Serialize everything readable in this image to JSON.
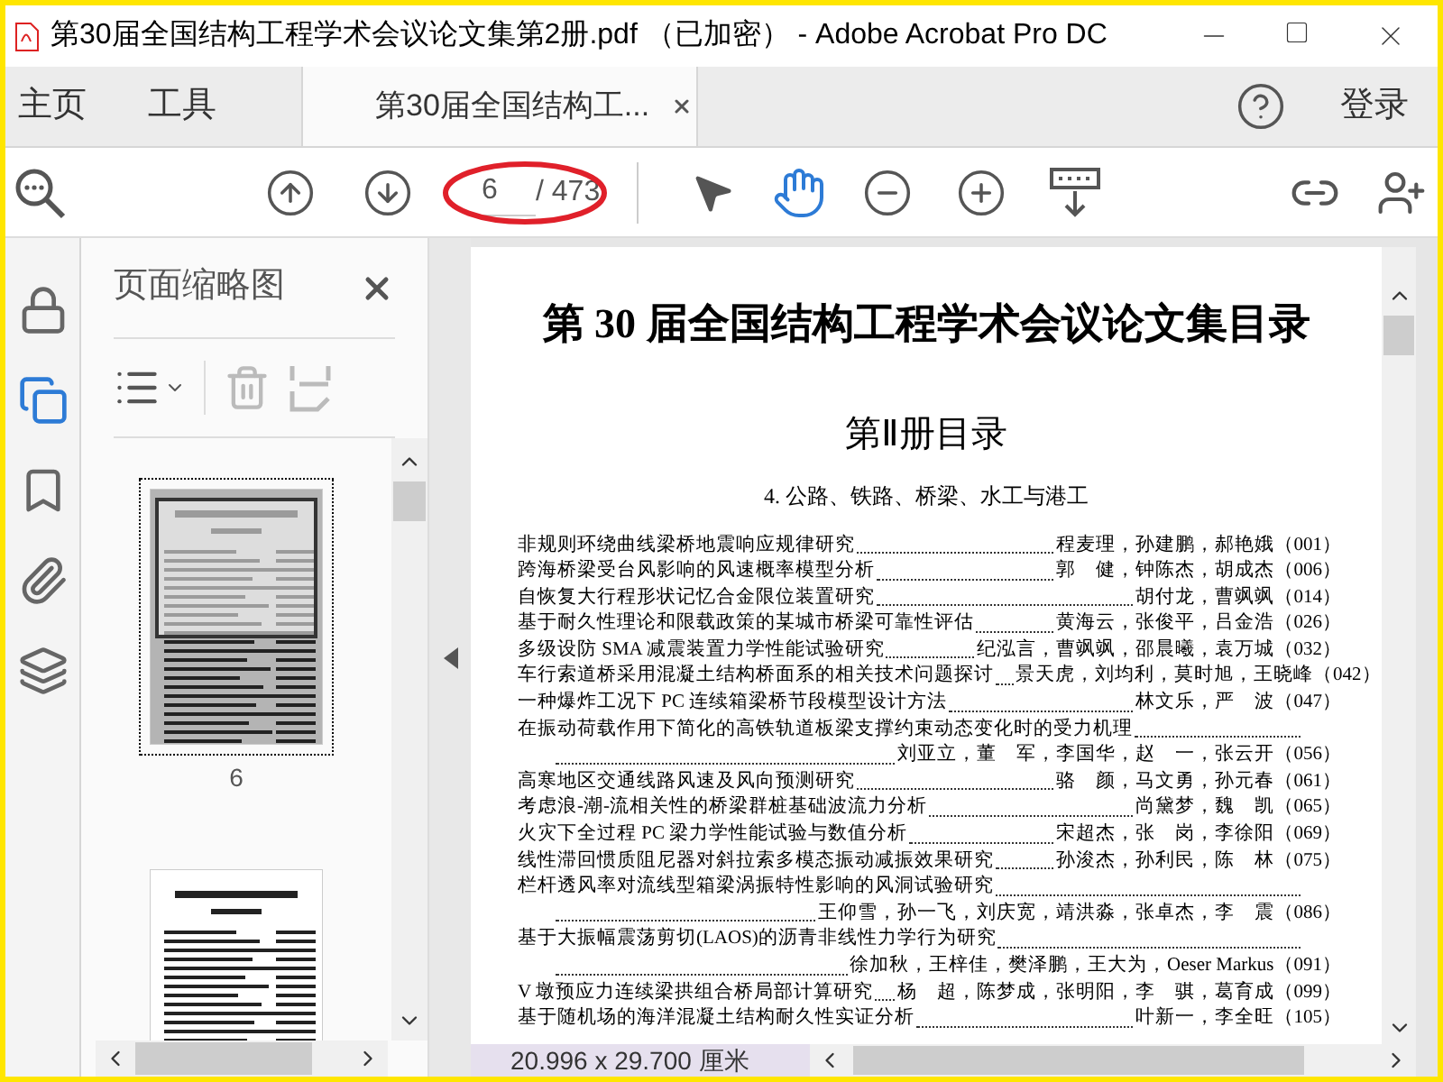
{
  "window": {
    "title": "第30届全国结构工程学术会议论文集第2册.pdf （已加密） - Adobe Acrobat Pro DC"
  },
  "tabs": [
    {
      "kind": "nav",
      "label": "主页",
      "selected": false
    },
    {
      "kind": "nav",
      "label": "工具",
      "selected": false
    },
    {
      "kind": "document",
      "label": "第30届全国结构工...",
      "selected": true
    }
  ],
  "sign_in": "登录",
  "page_field": {
    "value": "6",
    "total": "/ 473"
  },
  "rail": [
    {
      "kind": "lock",
      "selected": false
    },
    {
      "kind": "pages",
      "selected": true
    },
    {
      "kind": "bookmark",
      "selected": false
    },
    {
      "kind": "attachment",
      "selected": false
    },
    {
      "kind": "layers",
      "selected": false
    }
  ],
  "thumbnails": {
    "title": "页面缩略图",
    "pages": [
      {
        "label": "6",
        "selected": true
      },
      {
        "selected": false
      }
    ]
  },
  "document": {
    "heading": "第 30 届全国结构工程学术会议论文集目录",
    "subheading": "第Ⅱ册目录",
    "section": "4. 公路、铁路、桥梁、水工与港工",
    "entries": [
      {
        "kind": "single",
        "title": "非规则环绕曲线梁桥地震响应规律研究",
        "authors": "程麦理，孙建鹏，郝艳娥",
        "page": "（001）"
      },
      {
        "kind": "single",
        "title": "跨海桥梁受台风影响的风速概率模型分析",
        "authors": "郭　健，钟陈杰，胡成杰",
        "page": "（006）"
      },
      {
        "kind": "single",
        "title": "自恢复大行程形状记忆合金限位装置研究",
        "authors": "胡付龙，曹飒飒",
        "page": "（014）"
      },
      {
        "kind": "single",
        "title": "基于耐久性理论和限载政策的某城市桥梁可靠性评估",
        "authors": "黄海云，张俊平，吕金浩",
        "page": "（026）"
      },
      {
        "kind": "single",
        "title": "多级设防 SMA 减震装置力学性能试验研究",
        "authors": "纪泓言，曹飒飒，邵晨曦，袁万城",
        "page": "（032）"
      },
      {
        "kind": "single",
        "title": "车行索道桥采用混凝土结构桥面系的相关技术问题探讨",
        "authors": "景天虎，刘均利，莫时旭，王晓峰",
        "page": "（042）"
      },
      {
        "kind": "single",
        "title": "一种爆炸工况下 PC 连续箱梁桥节段模型设计方法",
        "authors": "林文乐，严　波",
        "page": "（047）"
      },
      {
        "kind": "wrapped",
        "title": "在振动荷载作用下简化的高铁轨道板梁支撑约束动态变化时的受力机理",
        "authors": "刘亚立，董　军，李国华，赵　一，张云开",
        "page": "（056）"
      },
      {
        "kind": "single",
        "title": "高寒地区交通线路风速及风向预测研究",
        "authors": "骆　颜，马文勇，孙元春",
        "page": "（061）"
      },
      {
        "kind": "single",
        "title": "考虑浪-潮-流相关性的桥梁群桩基础波流力分析",
        "authors": "尚黛梦，魏　凯",
        "page": "（065）"
      },
      {
        "kind": "single",
        "title": "火灾下全过程 PC 梁力学性能试验与数值分析",
        "authors": "宋超杰，张　岗，李徐阳",
        "page": "（069）"
      },
      {
        "kind": "single",
        "title": "线性滞回惯质阻尼器对斜拉索多模态振动减振效果研究",
        "authors": "孙浚杰，孙利民，陈　林",
        "page": "（075）"
      },
      {
        "kind": "wrapped",
        "title": "栏杆透风率对流线型箱梁涡振特性影响的风洞试验研究",
        "authors": "王仰雪，孙一飞，刘庆宽，靖洪淼，张卓杰，李　震",
        "page": "（086）"
      },
      {
        "kind": "wrapped",
        "title": "基于大振幅震荡剪切(LAOS)的沥青非线性力学行为研究",
        "authors": "徐加秋，王梓佳，樊泽鹏，王大为，Oeser Markus",
        "page": "（091）"
      },
      {
        "kind": "single",
        "title": "V 墩预应力连续梁拱组合桥局部计算研究",
        "authors": "杨　超，陈梦成，张明阳，李　骐，葛育成",
        "page": "（099）"
      },
      {
        "kind": "single",
        "title": "基于随机场的海洋混凝土结构耐久性实证分析",
        "authors": "叶新一，李全旺",
        "page": "（105）"
      }
    ]
  },
  "status": "20.996 x 29.700 厘米"
}
